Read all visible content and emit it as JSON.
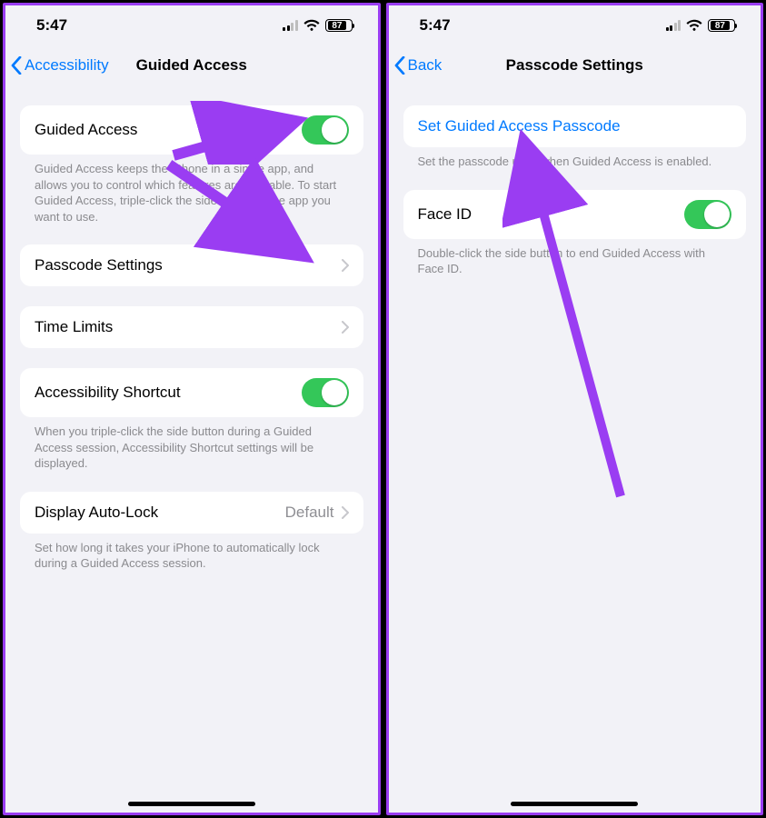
{
  "status": {
    "time": "5:47",
    "battery": "87"
  },
  "left": {
    "back_label": "Accessibility",
    "title": "Guided Access",
    "ga_label": "Guided Access",
    "ga_footer": "Guided Access keeps the iPhone in a single app, and allows you to control which features are available. To start Guided Access, triple-click the side button in the app you want to use.",
    "passcode_label": "Passcode Settings",
    "time_limits_label": "Time Limits",
    "shortcut_label": "Accessibility Shortcut",
    "shortcut_footer": "When you triple-click the side button during a Guided Access session, Accessibility Shortcut settings will be displayed.",
    "autolock_label": "Display Auto-Lock",
    "autolock_value": "Default",
    "autolock_footer": "Set how long it takes your iPhone to automatically lock during a Guided Access session."
  },
  "right": {
    "back_label": "Back",
    "title": "Passcode Settings",
    "set_passcode_label": "Set Guided Access Passcode",
    "set_passcode_footer": "Set the passcode used when Guided Access is enabled.",
    "faceid_label": "Face ID",
    "faceid_footer": "Double-click the side button to end Guided Access with Face ID."
  },
  "colors": {
    "accent": "#007aff",
    "toggle_on": "#34c759",
    "annotation": "#9a3df2"
  }
}
